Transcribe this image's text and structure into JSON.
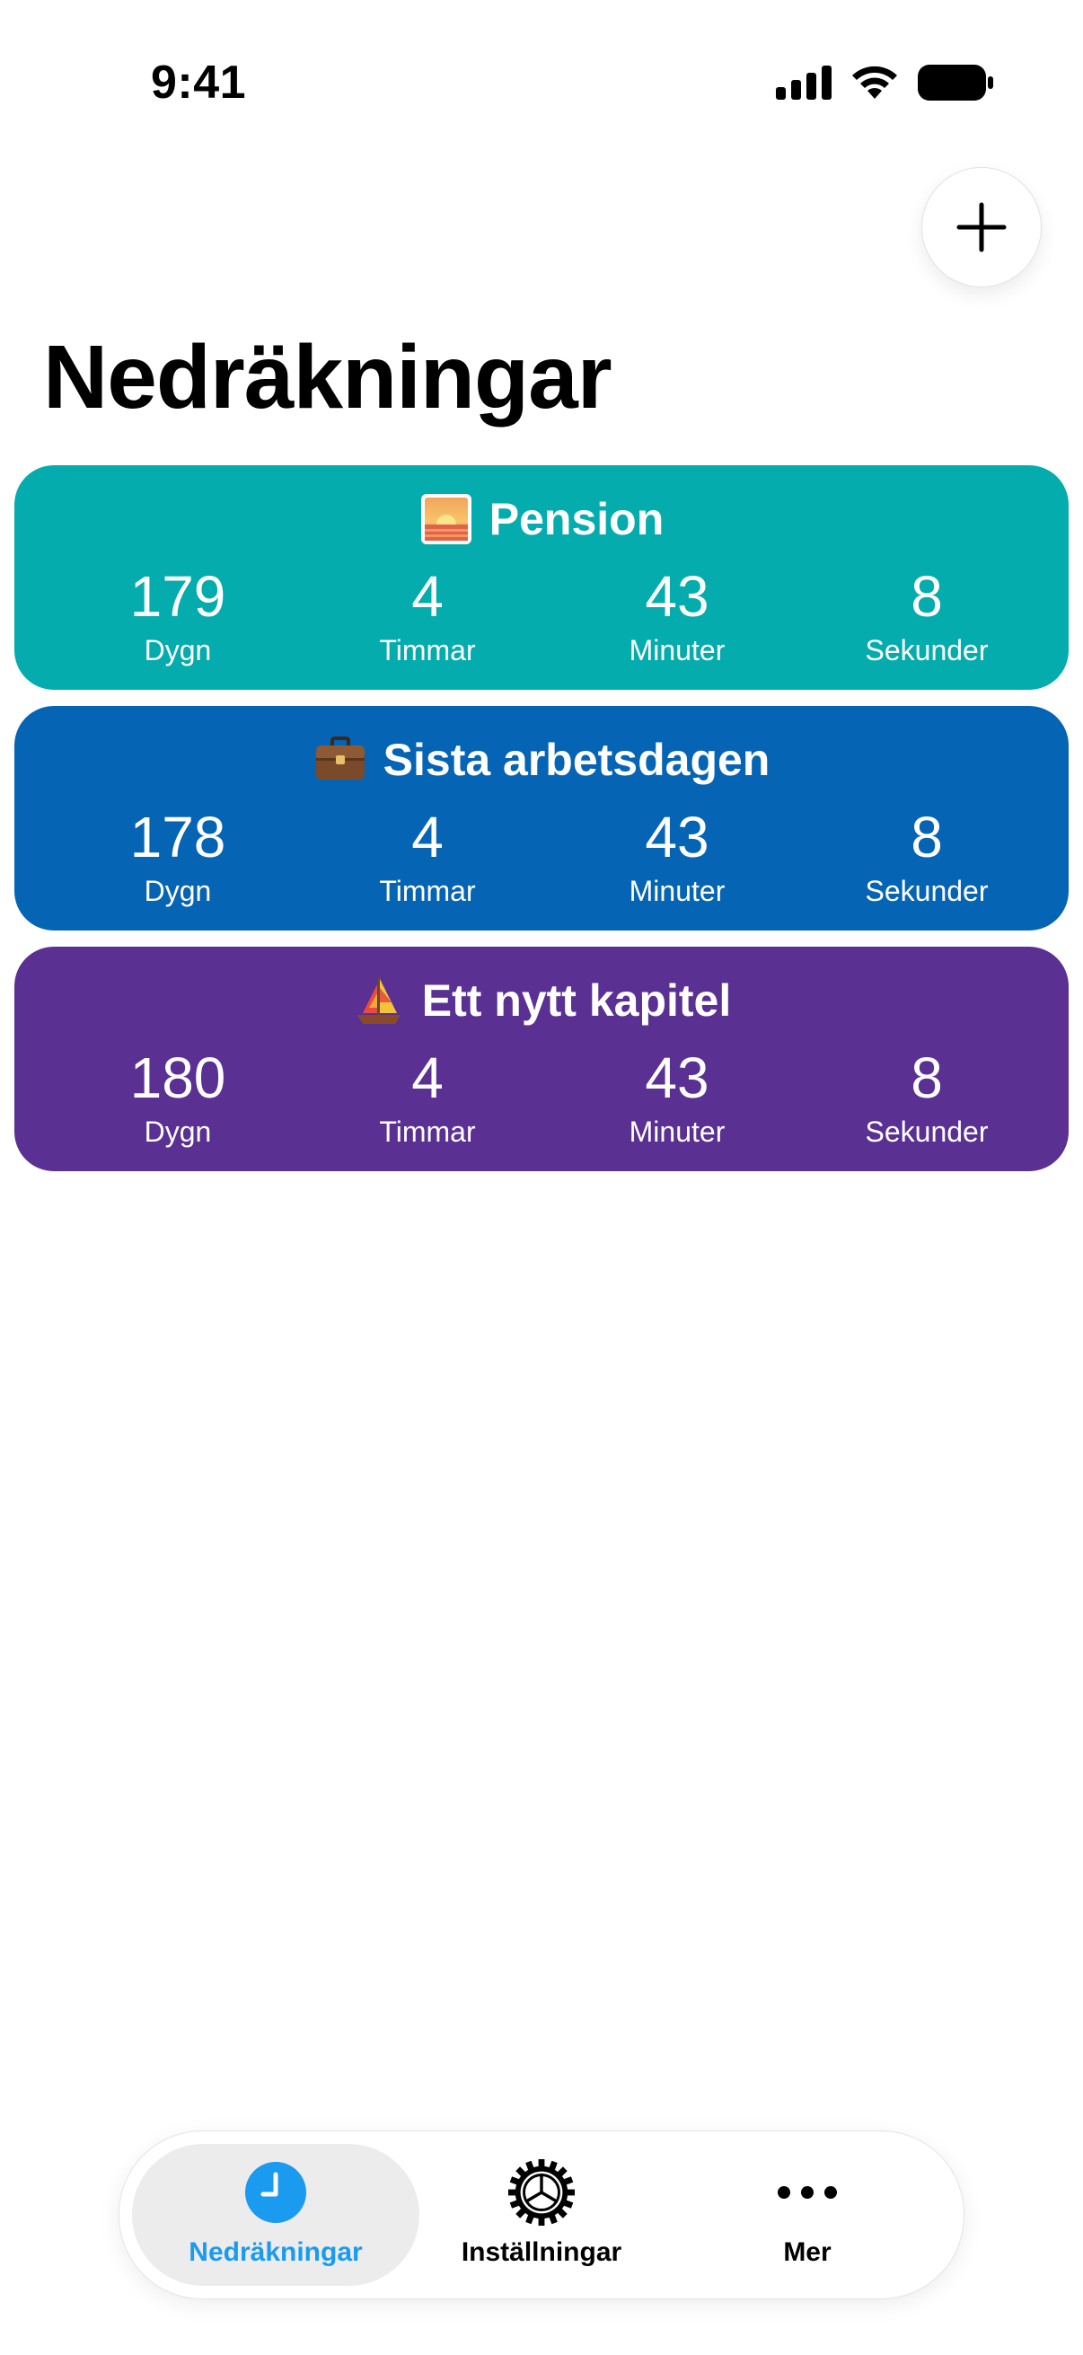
{
  "status_bar": {
    "time": "9:41"
  },
  "header": {
    "title": "Nedräkningar",
    "add_icon": "plus-icon"
  },
  "countdowns": [
    {
      "title": "Pension",
      "icon": "sunrise-icon",
      "color": "#04ACAE",
      "units": [
        {
          "value": "179",
          "label": "Dygn"
        },
        {
          "value": "4",
          "label": "Timmar"
        },
        {
          "value": "43",
          "label": "Minuter"
        },
        {
          "value": "8",
          "label": "Sekunder"
        }
      ]
    },
    {
      "title": "Sista arbetsdagen",
      "icon": "briefcase-icon",
      "color": "#0664B4",
      "units": [
        {
          "value": "178",
          "label": "Dygn"
        },
        {
          "value": "4",
          "label": "Timmar"
        },
        {
          "value": "43",
          "label": "Minuter"
        },
        {
          "value": "8",
          "label": "Sekunder"
        }
      ]
    },
    {
      "title": "Ett nytt kapitel",
      "icon": "sailboat-icon",
      "color": "#5A3093",
      "units": [
        {
          "value": "180",
          "label": "Dygn"
        },
        {
          "value": "4",
          "label": "Timmar"
        },
        {
          "value": "43",
          "label": "Minuter"
        },
        {
          "value": "8",
          "label": "Sekunder"
        }
      ]
    }
  ],
  "tab_bar": {
    "tabs": [
      {
        "label": "Nedräkningar",
        "icon": "clock-icon",
        "active": true
      },
      {
        "label": "Inställningar",
        "icon": "gear-icon",
        "active": false
      },
      {
        "label": "Mer",
        "icon": "more-icon",
        "active": false
      }
    ],
    "accent_color": "#1A9BF0"
  }
}
